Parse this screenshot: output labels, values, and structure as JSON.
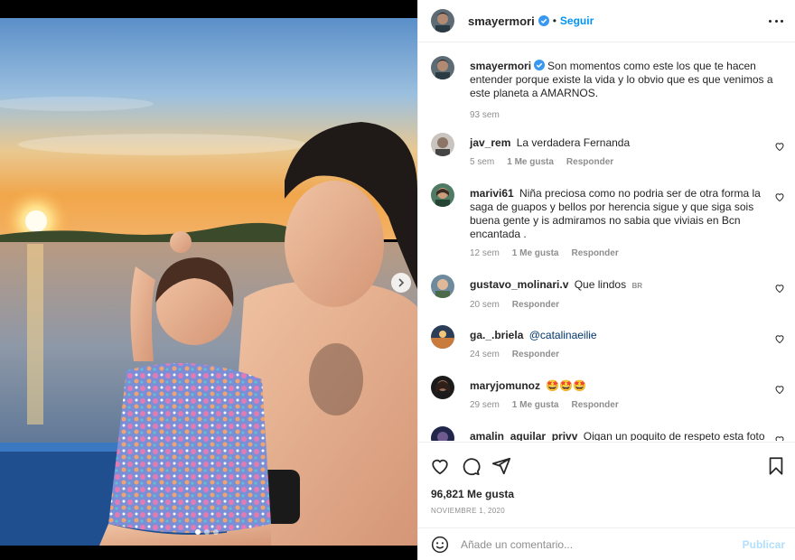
{
  "post": {
    "username": "smayermori",
    "follow_label": "Seguir",
    "separator": "•",
    "caption_username": "smayermori",
    "caption": "Son momentos como este los que te hacen entender porque existe la vida y lo obvio que es que venimos a este planeta a AMARNOS.",
    "caption_time": "93 sem",
    "likes": "96,821 Me gusta",
    "date": "NOVIEMBRE 1, 2020",
    "carousel": {
      "slides": 3,
      "active": 1
    }
  },
  "comments": [
    {
      "user": "jav_rem",
      "text": "La verdadera Fernanda",
      "time": "5 sem",
      "likes": "1 Me gusta",
      "reply": "Responder"
    },
    {
      "user": "marivi61",
      "text": "Niña preciosa como no podria ser de otra forma la saga de guapos y bellos por herencia sigue y que siga sois buena gente y is admiramos no sabia que viviais en Bcn encantada .",
      "time": "12 sem",
      "likes": "1 Me gusta",
      "reply": "Responder"
    },
    {
      "user": "gustavo_molinari.v",
      "text": "Que lindos",
      "flag": "BR",
      "time": "20 sem",
      "reply": "Responder"
    },
    {
      "user": "ga._.briela",
      "mention": "@catalinaeilie",
      "time": "24 sem",
      "reply": "Responder"
    },
    {
      "user": "maryjomunoz",
      "text": "🤩🤩🤩",
      "time": "29 sem",
      "likes": "1 Me gusta",
      "reply": "Responder"
    },
    {
      "user": "amalin_aguilar_privv",
      "text": "Oigan un poquito de respeto esta foto ni"
    }
  ],
  "add_comment": {
    "placeholder": "Añade un comentario...",
    "publish_label": "Publicar"
  },
  "icons": {
    "like": "heart-icon",
    "comment": "comment-icon",
    "share": "paper-plane-icon",
    "save": "bookmark-icon",
    "emoji": "smiley-icon",
    "more": "more-options-icon",
    "verified": "verified-badge-icon",
    "next": "chevron-right-icon"
  },
  "colors": {
    "accent": "#0095f6",
    "verified": "#3897f0",
    "text": "#262626",
    "muted": "#8e8e8e",
    "publish_disabled": "#b2dffc",
    "mention": "#00376b"
  }
}
